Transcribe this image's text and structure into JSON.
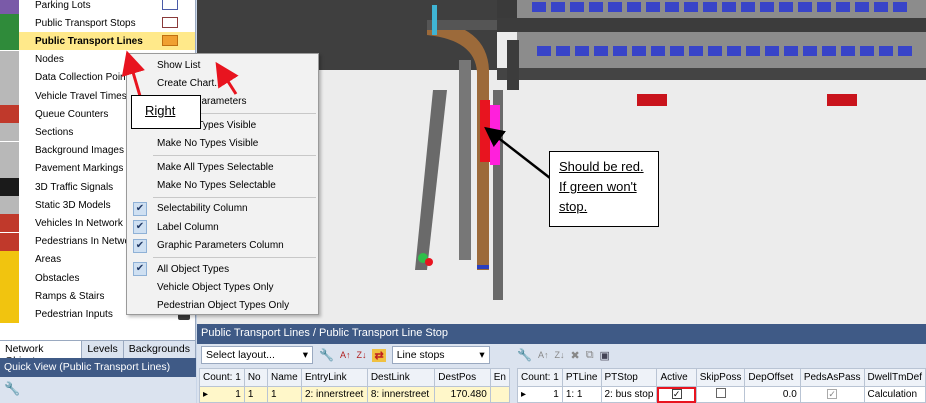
{
  "network_objects": [
    {
      "label": "Parking Lots",
      "icon": "parking-lot-icon",
      "color": "#7a5aa8",
      "swatch": true
    },
    {
      "label": "Public Transport Stops",
      "icon": "pt-stop-icon",
      "color": "#2f8b3a",
      "swatch": true
    },
    {
      "label": "Public Transport Lines",
      "icon": "pt-line-icon",
      "color": "#2f8b3a",
      "swatch": true,
      "selected": true
    },
    {
      "label": "Nodes",
      "icon": "node-icon",
      "color": "#b8b8b8"
    },
    {
      "label": "Data Collection Points",
      "icon": "data-collection-icon",
      "color": "#b8b8b8"
    },
    {
      "label": "Vehicle Travel Times",
      "icon": "stopwatch-icon",
      "color": "#b8b8b8"
    },
    {
      "label": "Queue Counters",
      "icon": "queue-counter-icon",
      "color": "#c0392b"
    },
    {
      "label": "Sections",
      "icon": "section-icon",
      "color": "#b8b8b8"
    },
    {
      "label": "Background Images",
      "icon": "image-icon",
      "color": "#b8b8b8"
    },
    {
      "label": "Pavement Markings",
      "icon": "pavement-icon",
      "color": "#b8b8b8"
    },
    {
      "label": "3D Traffic Signals",
      "icon": "traffic-signal-icon",
      "color": "#1a1a1a"
    },
    {
      "label": "Static 3D Models",
      "icon": "model-3d-icon",
      "color": "#b8b8b8"
    },
    {
      "label": "Vehicles In Network",
      "icon": "vehicle-icon",
      "color": "#c0392b"
    },
    {
      "label": "Pedestrians In Network",
      "icon": "pedestrian-icon",
      "color": "#c0392b"
    },
    {
      "label": "Areas",
      "icon": "area-icon",
      "color": "#f1c40f"
    },
    {
      "label": "Obstacles",
      "icon": "obstacle-icon",
      "color": "#f1c40f"
    },
    {
      "label": "Ramps & Stairs",
      "icon": "stairs-icon",
      "color": "#f1c40f"
    },
    {
      "label": "Pedestrian Inputs",
      "icon": "ped-input-icon",
      "color": "#f1c40f"
    }
  ],
  "left_tabs": [
    "Network Objects",
    "Levels",
    "Backgrounds"
  ],
  "quick_view_title": "Quick View (Public Transport Lines)",
  "context_menu": {
    "items": [
      {
        "label": "Show List"
      },
      {
        "label": "Create Chart..."
      },
      {
        "label": "Graphic Parameters"
      },
      {
        "sep": true
      },
      {
        "label": "Make All Types Visible"
      },
      {
        "label": "Make No Types Visible"
      },
      {
        "sep": true
      },
      {
        "label": "Make All Types Selectable"
      },
      {
        "label": "Make No Types Selectable"
      },
      {
        "sep": true
      },
      {
        "label": "Selectability Column",
        "checked": true
      },
      {
        "label": "Label Column",
        "checked": true
      },
      {
        "label": "Graphic Parameters Column",
        "checked": true
      },
      {
        "sep": true
      },
      {
        "label": "All Object Types",
        "checked": true
      },
      {
        "label": "Vehicle Object Types Only"
      },
      {
        "label": "Pedestrian Object Types Only"
      }
    ]
  },
  "callout_right": "Right",
  "callout_note": [
    "Should be red.",
    "If green won't",
    "stop."
  ],
  "bottom_title": "Public Transport Lines / Public Transport Line Stop",
  "layout_select": "Select layout...",
  "line_stops_select": "Line stops",
  "left_grid": {
    "headers": [
      "Count: 1",
      "No",
      "Name",
      "EntryLink",
      "DestLink",
      "DestPos",
      "En"
    ],
    "row": [
      "1",
      "1",
      "1",
      "2: innerstreet",
      "8: innerstreet",
      "170.480",
      ""
    ]
  },
  "right_grid": {
    "headers": [
      "Count: 1",
      "PTLine",
      "PTStop",
      "Active",
      "SkipPoss",
      "DepOffset",
      "PedsAsPass",
      "DwellTmDef"
    ],
    "row": [
      "1",
      "1: 1",
      "2: bus stop",
      "",
      "",
      "0.0",
      "",
      "Calculation"
    ]
  }
}
